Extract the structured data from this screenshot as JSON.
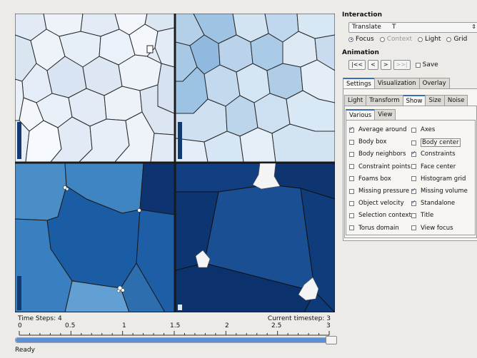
{
  "viewports": {
    "scales": {
      "legend_tl": 0.18,
      "legend_tr": 0.18,
      "legend_bl": 0.16,
      "legend_br": 0.06
    }
  },
  "timeline": {
    "time_steps_label": "Time Steps: 4",
    "current_label": "Current timestep: 3",
    "tick_labels": [
      "0",
      "0.5",
      "1",
      "1.5",
      "2",
      "2.5",
      "3"
    ],
    "slider_value": 3,
    "slider_max": 3
  },
  "status": "Ready",
  "panel": {
    "interaction_title": "Interaction",
    "mode_value": "Translate",
    "mode_key": "T",
    "radios": [
      {
        "label": "Focus",
        "checked": true,
        "disabled": false
      },
      {
        "label": "Context",
        "checked": false,
        "disabled": true
      },
      {
        "label": "Light",
        "checked": false,
        "disabled": false
      },
      {
        "label": "Grid",
        "checked": false,
        "disabled": false
      }
    ],
    "animation_title": "Animation",
    "nav_buttons": [
      "|<<",
      "<",
      ">",
      ">>|"
    ],
    "save_label": "Save",
    "main_tabs": [
      "Settings",
      "Visualization",
      "Overlay"
    ],
    "sub_tabs": [
      "Light",
      "Transform",
      "Show",
      "Size",
      "Noise"
    ],
    "show_tabs": [
      "Various",
      "View"
    ],
    "options_left": [
      {
        "label": "Average around",
        "checked": true
      },
      {
        "label": "Body box",
        "checked": false
      },
      {
        "label": "Body neighbors",
        "checked": false
      },
      {
        "label": "Constraint points",
        "checked": false
      },
      {
        "label": "Foams box",
        "checked": false
      },
      {
        "label": "Missing pressure",
        "checked": false
      },
      {
        "label": "Object velocity",
        "checked": false
      },
      {
        "label": "Selection context",
        "checked": false
      },
      {
        "label": "Torus domain",
        "checked": false
      }
    ],
    "options_right": [
      {
        "label": "Axes",
        "checked": false
      },
      {
        "label": "Body center",
        "checked": false
      },
      {
        "label": "Constraints",
        "checked": true
      },
      {
        "label": "Face center",
        "checked": false
      },
      {
        "label": "Histogram grid",
        "checked": false
      },
      {
        "label": "Missing volume",
        "checked": true
      },
      {
        "label": "Standalone",
        "checked": true
      },
      {
        "label": "Title",
        "checked": false
      },
      {
        "label": "View focus",
        "checked": false
      }
    ]
  }
}
